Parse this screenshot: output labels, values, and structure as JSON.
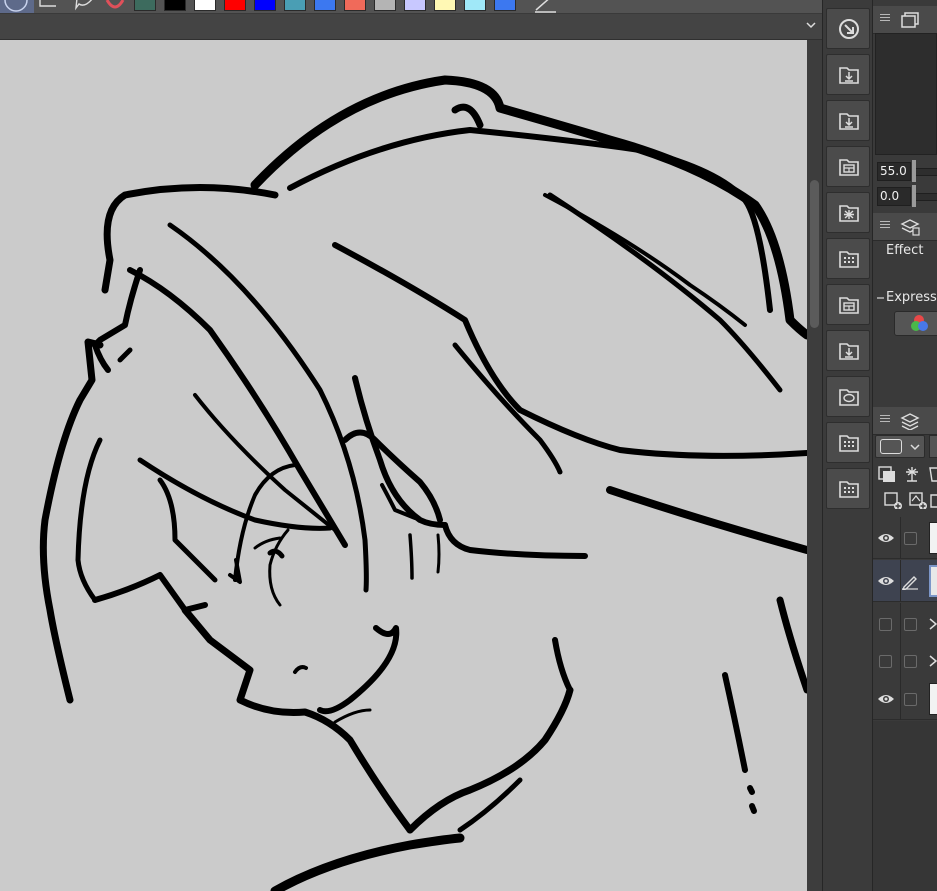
{
  "toolbar": {
    "swatches": [
      "#3d6b5e",
      "#000000",
      "#ffffff",
      "#ff0000",
      "#0000ff",
      "#4a9eb4",
      "#3c78f0",
      "#f06a5a",
      "#b4b4b4",
      "#c8c8ff",
      "#fff8b4",
      "#a0e8f8",
      "#3c78f0"
    ]
  },
  "navigator": {
    "zoom_value": "55.0",
    "rotate_value": "0.0"
  },
  "layer_property": {
    "effect_label": "Effect",
    "expression_label": "Expressi"
  },
  "command_icons": [
    "selection-launcher-icon",
    "import-folder-icon",
    "import-file-icon",
    "layout-icon",
    "bug-icon",
    "grid-icon",
    "layout-icon",
    "import-file-icon",
    "speech-bubble-icon",
    "grid-icon",
    "grid-icon"
  ],
  "accent_colors": {
    "selection": "#7c96c8",
    "panel": "#3a3a3a",
    "canvas": "#cbcbcb"
  }
}
